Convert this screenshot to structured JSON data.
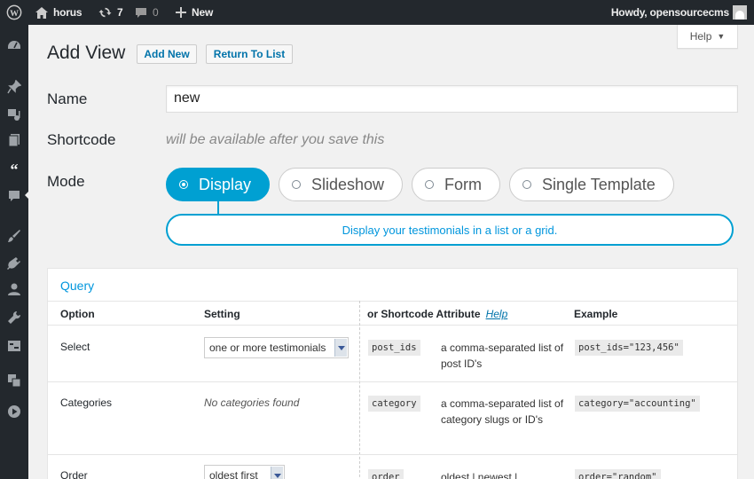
{
  "adminbar": {
    "site_name": "horus",
    "updates_count": "7",
    "comments_count": "0",
    "new_label": "New",
    "howdy": "Howdy, opensourcecms"
  },
  "sidebar": {
    "icons": [
      "dashboard-icon",
      "pin-icon",
      "media-icon",
      "pages-icon",
      "testimonials-quote-icon",
      "comments-icon",
      "appearance-brush-icon",
      "plugins-icon",
      "users-icon",
      "tools-wrench-icon",
      "settings-icon",
      "translate-icon",
      "play-icon"
    ],
    "active": "testimonials-quote-icon"
  },
  "help_tab": {
    "label": "Help",
    "arrow": "▼"
  },
  "header": {
    "title": "Add View",
    "add_new": "Add New",
    "return_to_list": "Return To List"
  },
  "form": {
    "name_label": "Name",
    "name_value": "new",
    "shortcode_label": "Shortcode",
    "shortcode_note": "will be available after you save this",
    "mode_label": "Mode",
    "modes": [
      "Display",
      "Slideshow",
      "Form",
      "Single Template"
    ],
    "selected_mode": "Display",
    "mode_description": "Display your testimonials in a list or a grid."
  },
  "query": {
    "title": "Query",
    "headers": {
      "option": "Option",
      "setting": "Setting",
      "attribute": "or Shortcode Attribute",
      "help": "Help",
      "example": "Example"
    },
    "rows": [
      {
        "option": "Select",
        "setting": "one or more testimonials",
        "attribute": "post_ids",
        "description": "a comma-separated list of post ID's",
        "example": "post_ids=\"123,456\""
      },
      {
        "option": "Categories",
        "setting": "No categories found",
        "attribute": "category",
        "description": "a comma-separated list of category slugs or ID's",
        "example": "category=\"accounting\""
      },
      {
        "option": "Order",
        "setting": "oldest first",
        "attribute": "order",
        "description": "oldest | newest |",
        "example": "order=\"random\""
      }
    ]
  },
  "colors": {
    "adminbar_bg": "#23282d",
    "accent": "#00a0d2",
    "link": "#0073aa",
    "page_bg": "#f1f1f1"
  }
}
